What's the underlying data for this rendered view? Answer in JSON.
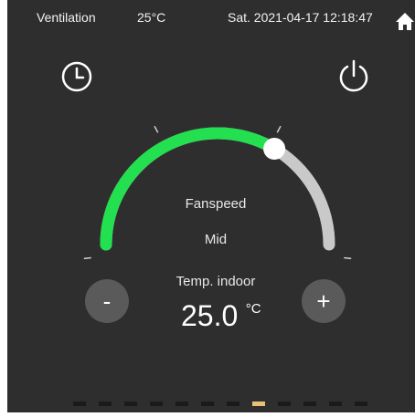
{
  "status_bar": {
    "mode": "Ventilation",
    "outdoor_temp": "25°C",
    "datetime": "Sat. 2021-04-17 12:18:47"
  },
  "icons": {
    "timer": "clock-icon",
    "power": "power-icon",
    "home": "home-icon"
  },
  "dial": {
    "title": "Fanspeed",
    "value": "Mid",
    "level_fraction": 0.67,
    "active_color": "#22e04f",
    "inactive_color": "#c9c9c9"
  },
  "temperature": {
    "label": "Temp. indoor",
    "value": "25.0",
    "unit": "°C"
  },
  "controls": {
    "minus_label": "-",
    "plus_label": "+"
  },
  "pager": {
    "total": 12,
    "active_index": 7
  }
}
